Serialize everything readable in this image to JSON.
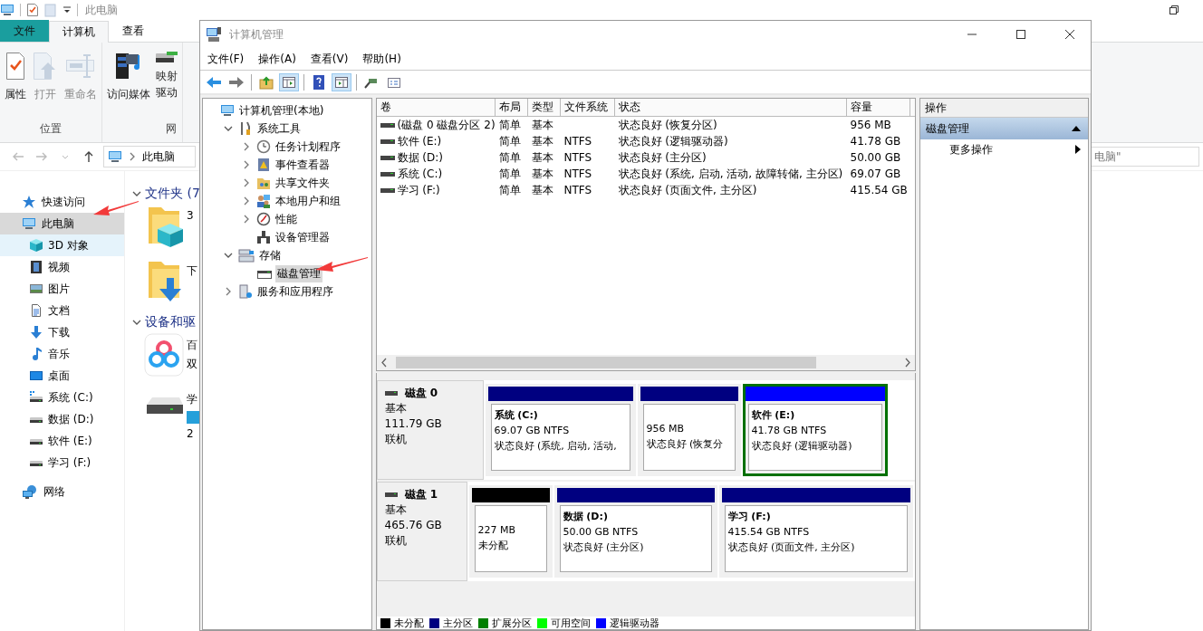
{
  "explorer": {
    "title": "此电脑",
    "ribbon_tabs": [
      {
        "label": "文件",
        "kind": "file",
        "selected": false
      },
      {
        "label": "计算机",
        "kind": "tab",
        "selected": true
      },
      {
        "label": "查看",
        "kind": "tab",
        "selected": false
      }
    ],
    "ribbon_buttons": [
      {
        "label": "属性",
        "disabled": false
      },
      {
        "label": "打开",
        "disabled": true
      },
      {
        "label": "重命名",
        "disabled": true
      },
      {
        "label": "访问媒体",
        "disabled": false
      },
      {
        "label": "映射驱动",
        "disabled": false
      }
    ],
    "ribbon_groups": [
      "位置",
      "网"
    ],
    "address": "此电脑",
    "search": "电脑\"",
    "nav": [
      {
        "label": "快速访问",
        "selected": false
      },
      {
        "label": "此电脑",
        "selected": true,
        "children": [
          {
            "label": "3D 对象",
            "highlighted": true
          },
          {
            "label": "视频",
            "highlighted": false
          },
          {
            "label": "图片",
            "highlighted": false
          },
          {
            "label": "文档",
            "highlighted": false
          },
          {
            "label": "下载",
            "highlighted": false
          },
          {
            "label": "音乐",
            "highlighted": false
          },
          {
            "label": "桌面",
            "highlighted": false
          },
          {
            "label": "系统 (C:)",
            "highlighted": false
          },
          {
            "label": "数据 (D:)",
            "highlighted": false
          },
          {
            "label": "软件 (E:)",
            "highlighted": false
          },
          {
            "label": "学习 (F:)",
            "highlighted": false
          }
        ]
      },
      {
        "label": "网络",
        "selected": false
      }
    ],
    "sections": [
      {
        "header": "文件夹 (7",
        "items": [
          {
            "title": "3"
          },
          {
            "title": "下"
          }
        ]
      },
      {
        "header": "设备和驱",
        "items": [
          {
            "title": "百",
            "subtitle": "双"
          },
          {
            "title": "学",
            "subtitle": "2"
          }
        ]
      }
    ]
  },
  "window": {
    "title": "计算机管理",
    "menu": [
      "文件(F)",
      "操作(A)",
      "查看(V)",
      "帮助(H)"
    ],
    "toolbar": [
      {
        "pressed": false
      },
      {
        "pressed": false
      },
      {
        "pressed": false
      },
      {
        "pressed": true
      },
      {
        "pressed": false
      },
      {
        "pressed": true
      },
      {
        "pressed": false
      },
      {
        "pressed": false
      }
    ],
    "tree": [
      {
        "label": "计算机管理(本地)",
        "selected": false,
        "children": [
          {
            "label": "系统工具",
            "expanded": true,
            "selected": false,
            "children": [
              {
                "label": "任务计划程序",
                "expanded": false,
                "selected": false
              },
              {
                "label": "事件查看器",
                "expanded": false,
                "selected": false
              },
              {
                "label": "共享文件夹",
                "expanded": false,
                "selected": false
              },
              {
                "label": "本地用户和组",
                "expanded": false,
                "selected": false
              },
              {
                "label": "性能",
                "expanded": false,
                "selected": false
              },
              {
                "label": "设备管理器",
                "selected": false
              }
            ]
          },
          {
            "label": "存储",
            "expanded": true,
            "selected": false,
            "children": [
              {
                "label": "磁盘管理",
                "selected": true
              }
            ]
          },
          {
            "label": "服务和应用程序",
            "expanded": false,
            "selected": false
          }
        ]
      }
    ],
    "volumes": {
      "columns": [
        "卷",
        "布局",
        "类型",
        "文件系统",
        "状态",
        "容量"
      ],
      "rows": [
        {
          "volume": "(磁盘 0 磁盘分区 2)",
          "layout": "简单",
          "type": "基本",
          "status": "状态良好 (恢复分区)",
          "capacity": "956 MB"
        },
        {
          "volume": "软件 (E:)",
          "layout": "简单",
          "type": "基本",
          "fs": "NTFS",
          "status": "状态良好 (逻辑驱动器)",
          "capacity": "41.78 GB"
        },
        {
          "volume": "数据 (D:)",
          "layout": "简单",
          "type": "基本",
          "fs": "NTFS",
          "status": "状态良好 (主分区)",
          "capacity": "50.00 GB"
        },
        {
          "volume": "系统 (C:)",
          "layout": "简单",
          "type": "基本",
          "fs": "NTFS",
          "status": "状态良好 (系统, 启动, 活动, 故障转储, 主分区)",
          "capacity": "69.07 GB"
        },
        {
          "volume": "学习 (F:)",
          "layout": "简单",
          "type": "基本",
          "fs": "NTFS",
          "status": "状态良好 (页面文件, 主分区)",
          "capacity": "415.54 GB"
        }
      ]
    },
    "disks": [
      {
        "name": "磁盘 0",
        "type": "基本",
        "size": "111.79 GB",
        "state": "联机",
        "partitions": [
          {
            "title": "系统 (C:)",
            "size": "69.07 GB NTFS",
            "status": "状态良好 (系统, 启动, 活动,",
            "color": "#000080",
            "selected": false
          },
          {
            "size": "956 MB",
            "status": "状态良好 (恢复分",
            "color": "#000080",
            "selected": false
          },
          {
            "title": "软件 (E:)",
            "size": "41.78 GB NTFS",
            "status": "状态良好 (逻辑驱动器)",
            "color": "#0000ff",
            "selected": true
          }
        ]
      },
      {
        "name": "磁盘 1",
        "type": "基本",
        "size": "465.76 GB",
        "state": "联机",
        "partitions": [
          {
            "size": "227 MB",
            "status": "未分配",
            "color": "#000000",
            "selected": false
          },
          {
            "title": "数据 (D:)",
            "size": "50.00 GB NTFS",
            "status": "状态良好 (主分区)",
            "color": "#000080",
            "selected": false
          },
          {
            "title": "学习 (F:)",
            "size": "415.54 GB NTFS",
            "status": "状态良好 (页面文件, 主分区)",
            "color": "#000080",
            "selected": false
          }
        ]
      }
    ],
    "legend": [
      {
        "label": "未分配",
        "color": "#000000"
      },
      {
        "label": "主分区",
        "color": "#000080"
      },
      {
        "label": "扩展分区",
        "color": "#008000"
      },
      {
        "label": "可用空间",
        "color": "#00ff00"
      },
      {
        "label": "逻辑驱动器",
        "color": "#0000ff"
      }
    ],
    "actions": {
      "header": "操作",
      "sections": [
        {
          "title": "磁盘管理",
          "expanded": true,
          "items": [
            "更多操作"
          ]
        }
      ]
    }
  }
}
